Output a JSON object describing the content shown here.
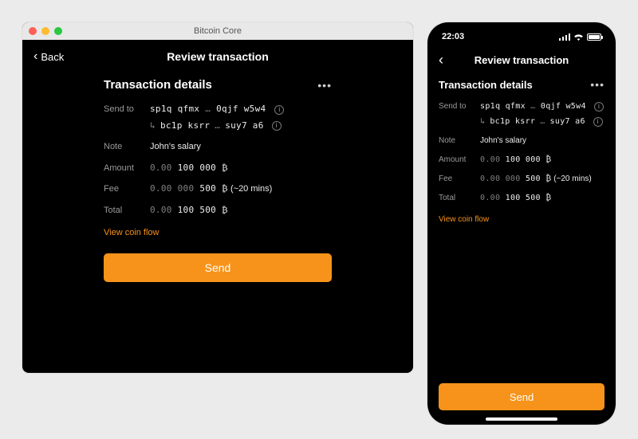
{
  "desktop": {
    "window_title": "Bitcoin Core",
    "back_label": "Back",
    "header_title": "Review transaction",
    "section_title": "Transaction details",
    "labels": {
      "send_to": "Send to",
      "note": "Note",
      "amount": "Amount",
      "fee": "Fee",
      "total": "Total"
    },
    "address": {
      "p1": "sp1q qfmx",
      "p2": "0qjf w5w4",
      "sub_p1": "bc1p ksrr",
      "sub_p2": "suy7 a6"
    },
    "note": "John's salary",
    "amount": {
      "dim": "0.00",
      "strong": " 100 000",
      "unit": " ₿"
    },
    "fee": {
      "dim": "0.00 000",
      "strong": " 500",
      "unit": " ₿",
      "extra": " (~20 mins)"
    },
    "total": {
      "dim": "0.00",
      "strong": " 100 500",
      "unit": " ₿"
    },
    "link_label": "View coin flow",
    "send_label": "Send"
  },
  "mobile": {
    "time": "22:03",
    "header_title": "Review transaction",
    "section_title": "Transaction details",
    "labels": {
      "send_to": "Send to",
      "note": "Note",
      "amount": "Amount",
      "fee": "Fee",
      "total": "Total"
    },
    "address": {
      "p1": "sp1q qfmx",
      "p2": "0qjf w5w4",
      "sub_p1": "bc1p ksrr",
      "sub_p2": "suy7 a6"
    },
    "note": "John's salary",
    "amount": {
      "dim": "0.00",
      "strong": " 100 000",
      "unit": " ₿"
    },
    "fee": {
      "dim": "0.00 000",
      "strong": " 500",
      "unit": " ₿",
      "extra": " (~20 mins)"
    },
    "total": {
      "dim": "0.00",
      "strong": " 100 500",
      "unit": " ₿"
    },
    "link_label": "View coin flow",
    "send_label": "Send"
  },
  "glyphs": {
    "ellipsis_mid": "…",
    "info": "i",
    "reply": "↳"
  },
  "colors": {
    "accent": "#f7931a"
  }
}
